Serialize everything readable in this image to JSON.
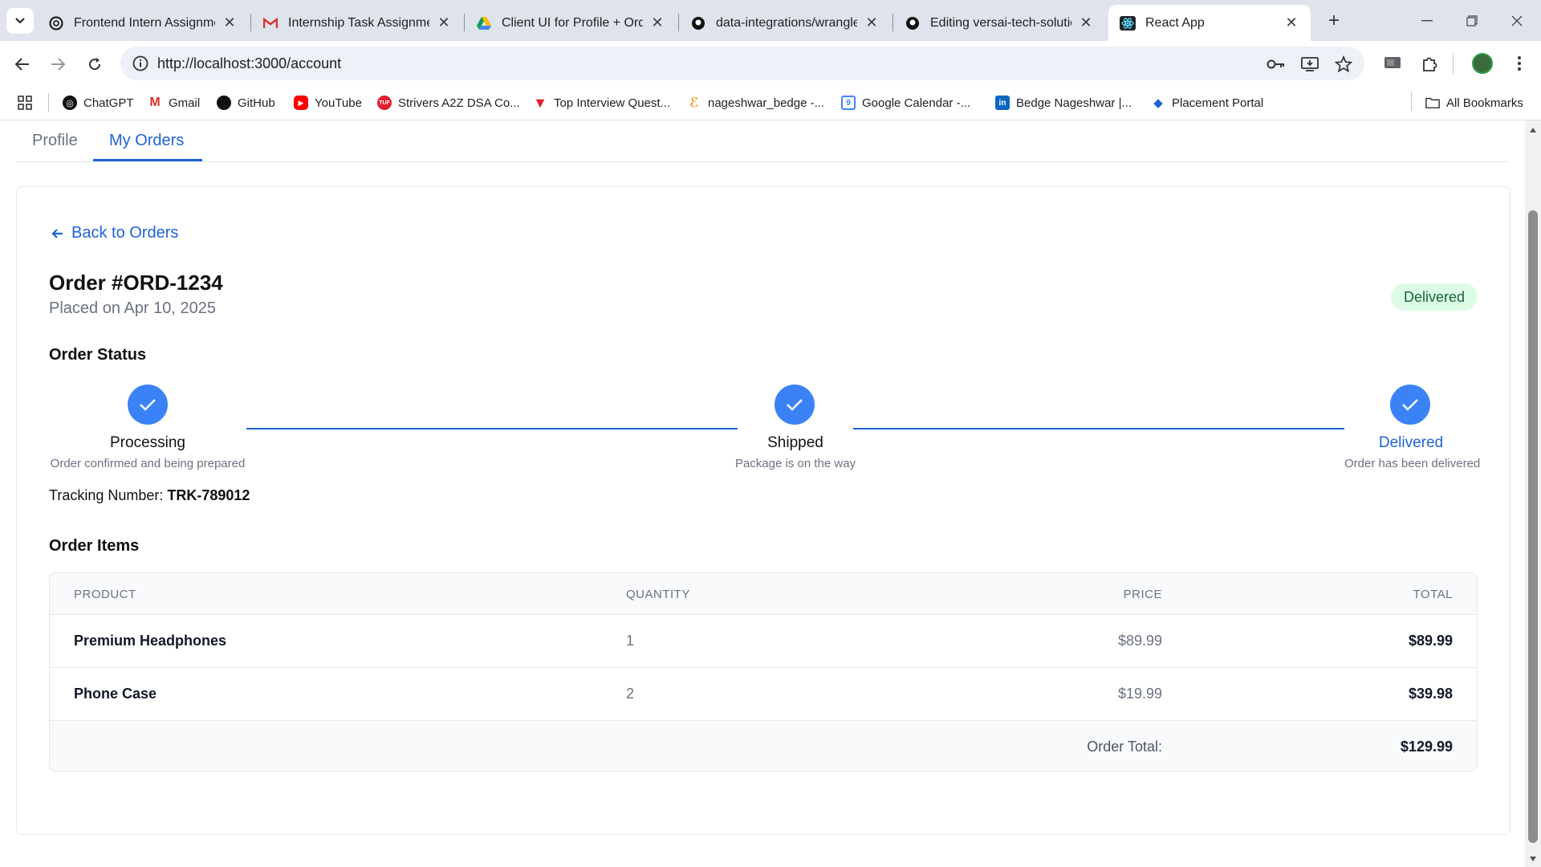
{
  "browser": {
    "tabs": [
      {
        "title": "Frontend Intern Assignmer",
        "icon": "chatgpt-icon"
      },
      {
        "title": "Internship Task Assignment",
        "icon": "gmail-icon"
      },
      {
        "title": "Client UI for Profile + Orde",
        "icon": "google-drive-icon"
      },
      {
        "title": "data-integrations/wrangler",
        "icon": "github-icon"
      },
      {
        "title": "Editing versai-tech-solution",
        "icon": "github-icon"
      },
      {
        "title": "React App",
        "icon": "react-icon"
      }
    ],
    "url": "http://localhost:3000/account",
    "bookmarks": [
      {
        "label": "ChatGPT",
        "icon": "chatgpt-icon"
      },
      {
        "label": "Gmail",
        "icon": "gmail-icon"
      },
      {
        "label": "GitHub",
        "icon": "github-icon"
      },
      {
        "label": "YouTube",
        "icon": "youtube-icon"
      },
      {
        "label": "Strivers A2Z DSA Co...",
        "icon": "tuf-icon"
      },
      {
        "label": "Top Interview Quest...",
        "icon": "tle-icon"
      },
      {
        "label": "nageshwar_bedge -...",
        "icon": "leetcode-icon"
      },
      {
        "label": "Google Calendar -...",
        "icon": "calendar-icon"
      },
      {
        "label": "Bedge Nageshwar |...",
        "icon": "linkedin-icon"
      },
      {
        "label": "Placement Portal",
        "icon": "portal-icon"
      }
    ],
    "all_bookmarks": "All Bookmarks"
  },
  "page": {
    "tabs": [
      "Profile",
      "My Orders"
    ],
    "back_label": "Back to Orders",
    "order_title": "Order #ORD-1234",
    "placed_on": "Placed on Apr 10, 2025",
    "status_badge": "Delivered",
    "status_heading": "Order Status",
    "steps": [
      {
        "title": "Processing",
        "desc": "Order confirmed and being prepared"
      },
      {
        "title": "Shipped",
        "desc": "Package is on the way"
      },
      {
        "title": "Delivered",
        "desc": "Order has been delivered"
      }
    ],
    "tracking_label": "Tracking Number:",
    "tracking_number": "TRK-789012",
    "items_heading": "Order Items",
    "table": {
      "headers": [
        "PRODUCT",
        "QUANTITY",
        "PRICE",
        "TOTAL"
      ],
      "rows": [
        {
          "product": "Premium Headphones",
          "quantity": "1",
          "price": "$89.99",
          "total": "$89.99"
        },
        {
          "product": "Phone Case",
          "quantity": "2",
          "price": "$19.99",
          "total": "$39.98"
        }
      ],
      "total_label": "Order Total:",
      "total_value": "$129.99"
    }
  },
  "colors": {
    "accent": "#1e63d6",
    "step": "#3b82f6",
    "badge_bg": "#dcfce7",
    "badge_text": "#166534"
  }
}
